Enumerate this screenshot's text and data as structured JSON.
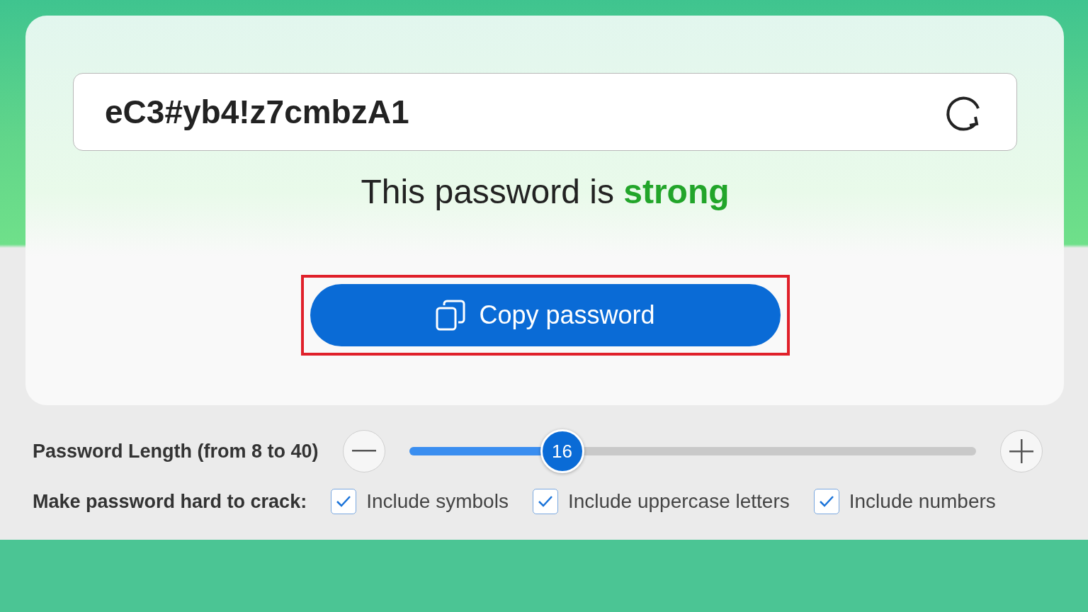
{
  "password_field": {
    "value": "eC3#yb4!z7cmbzA1"
  },
  "strength": {
    "text": "This password is **strong**"
  },
  "copy_button": {
    "label": "Copy password",
    "highlighted": true
  },
  "length": {
    "label": "Password Length (from 8 to 40)",
    "value": "16",
    "level": 0.27
  },
  "options": {
    "label": "Make password hard to crack:",
    "items": [
      {
        "label": "Include symbols",
        "checked": true
      },
      {
        "label": "Include uppercase letters",
        "checked": true
      },
      {
        "label": "Include numbers",
        "checked": true
      }
    ]
  }
}
